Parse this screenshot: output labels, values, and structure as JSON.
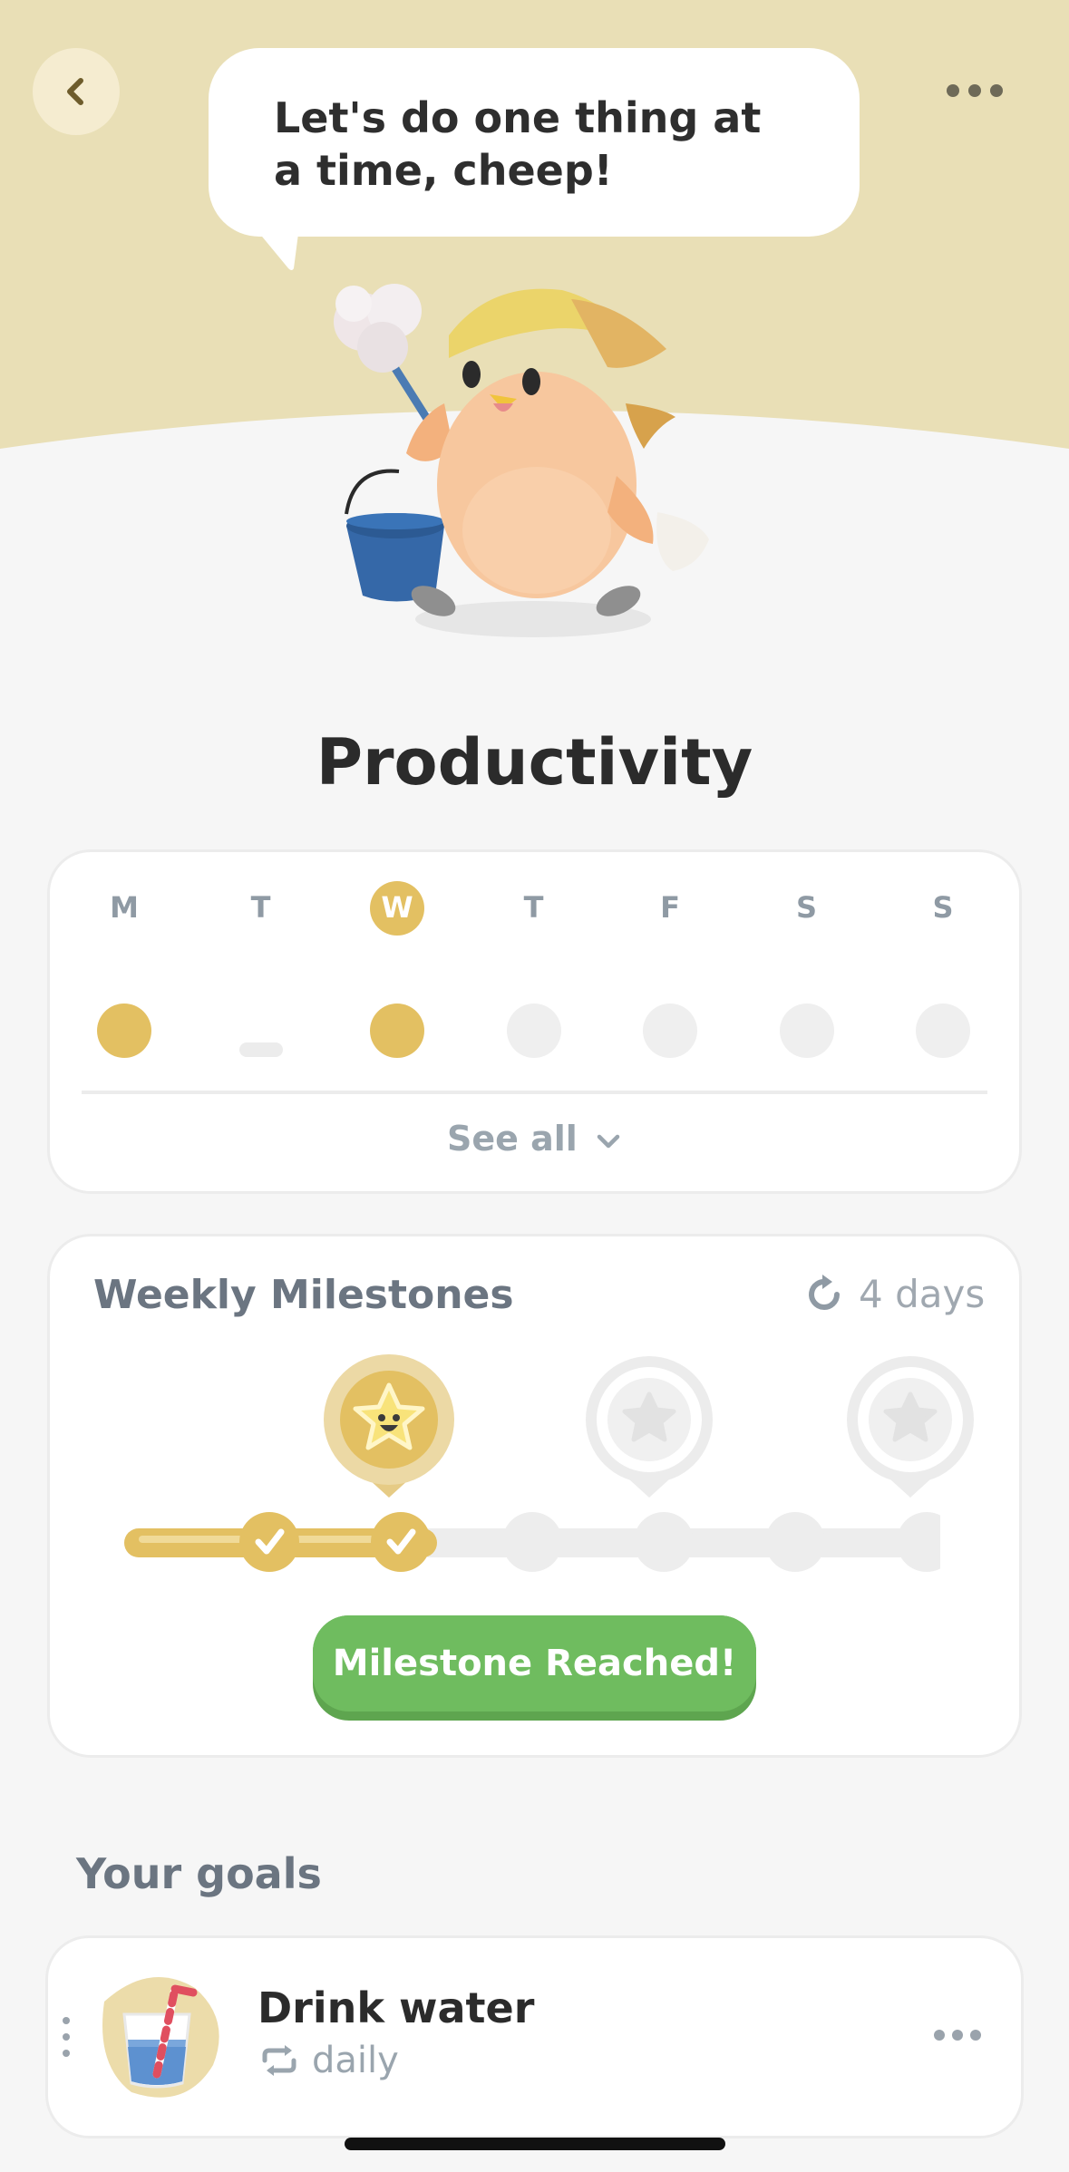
{
  "header": {
    "speech_bubble": "Let's do one thing at a time, cheep!",
    "back_icon": "chevron-left-icon",
    "more_icon": "ellipsis-icon"
  },
  "page": {
    "title": "Productivity"
  },
  "week": {
    "days": [
      {
        "letter": "M",
        "status": "done",
        "active": false
      },
      {
        "letter": "T",
        "status": "skipped",
        "active": false
      },
      {
        "letter": "W",
        "status": "done",
        "active": true
      },
      {
        "letter": "T",
        "status": "empty",
        "active": false
      },
      {
        "letter": "F",
        "status": "empty",
        "active": false
      },
      {
        "letter": "S",
        "status": "empty",
        "active": false
      },
      {
        "letter": "S",
        "status": "empty",
        "active": false
      }
    ],
    "see_all_label": "See all"
  },
  "milestones": {
    "title": "Weekly Milestones",
    "days_left": "4 days",
    "steps_completed": 2,
    "steps_total": 7,
    "reached_button": "Milestone Reached!"
  },
  "goals": {
    "heading": "Your goals",
    "items": [
      {
        "title": "Drink water",
        "frequency": "daily",
        "icon": "water-glass-icon"
      }
    ]
  },
  "colors": {
    "accent_gold": "#e3c062",
    "hero_bg": "#e9dfb6",
    "button_green": "#6fbc5f",
    "page_bg": "#f6f6f6"
  }
}
